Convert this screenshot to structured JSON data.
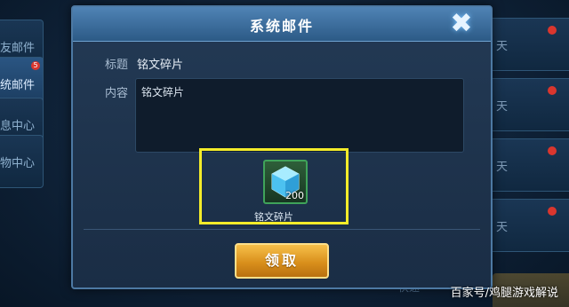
{
  "background": {
    "tabs": [
      {
        "label": "友邮件",
        "badge": ""
      },
      {
        "label": "统邮件",
        "badge": "5"
      },
      {
        "label": "息中心",
        "badge": ""
      },
      {
        "label": "物中心",
        "badge": ""
      }
    ],
    "rows": [
      {
        "day": "天"
      },
      {
        "day": "天"
      },
      {
        "day": "天"
      },
      {
        "day": "天"
      },
      {
        "day": "天"
      }
    ],
    "bottom_text": "快速"
  },
  "dialog": {
    "title": "系统邮件",
    "close_glyph": "✖",
    "title_label": "标题",
    "title_value": "铭文碎片",
    "content_label": "内容",
    "content_value": "铭文碎片",
    "attachment": {
      "name": "铭文碎片",
      "count": "200",
      "icon": "crystal-cube-icon",
      "color": "#4fd0ff"
    },
    "claim_label": "领取"
  },
  "watermark": "百家号/鸡腿游戏解说",
  "colors": {
    "accent": "#4f83b5",
    "highlight": "#f4ec2a",
    "button": "#d9901c"
  }
}
